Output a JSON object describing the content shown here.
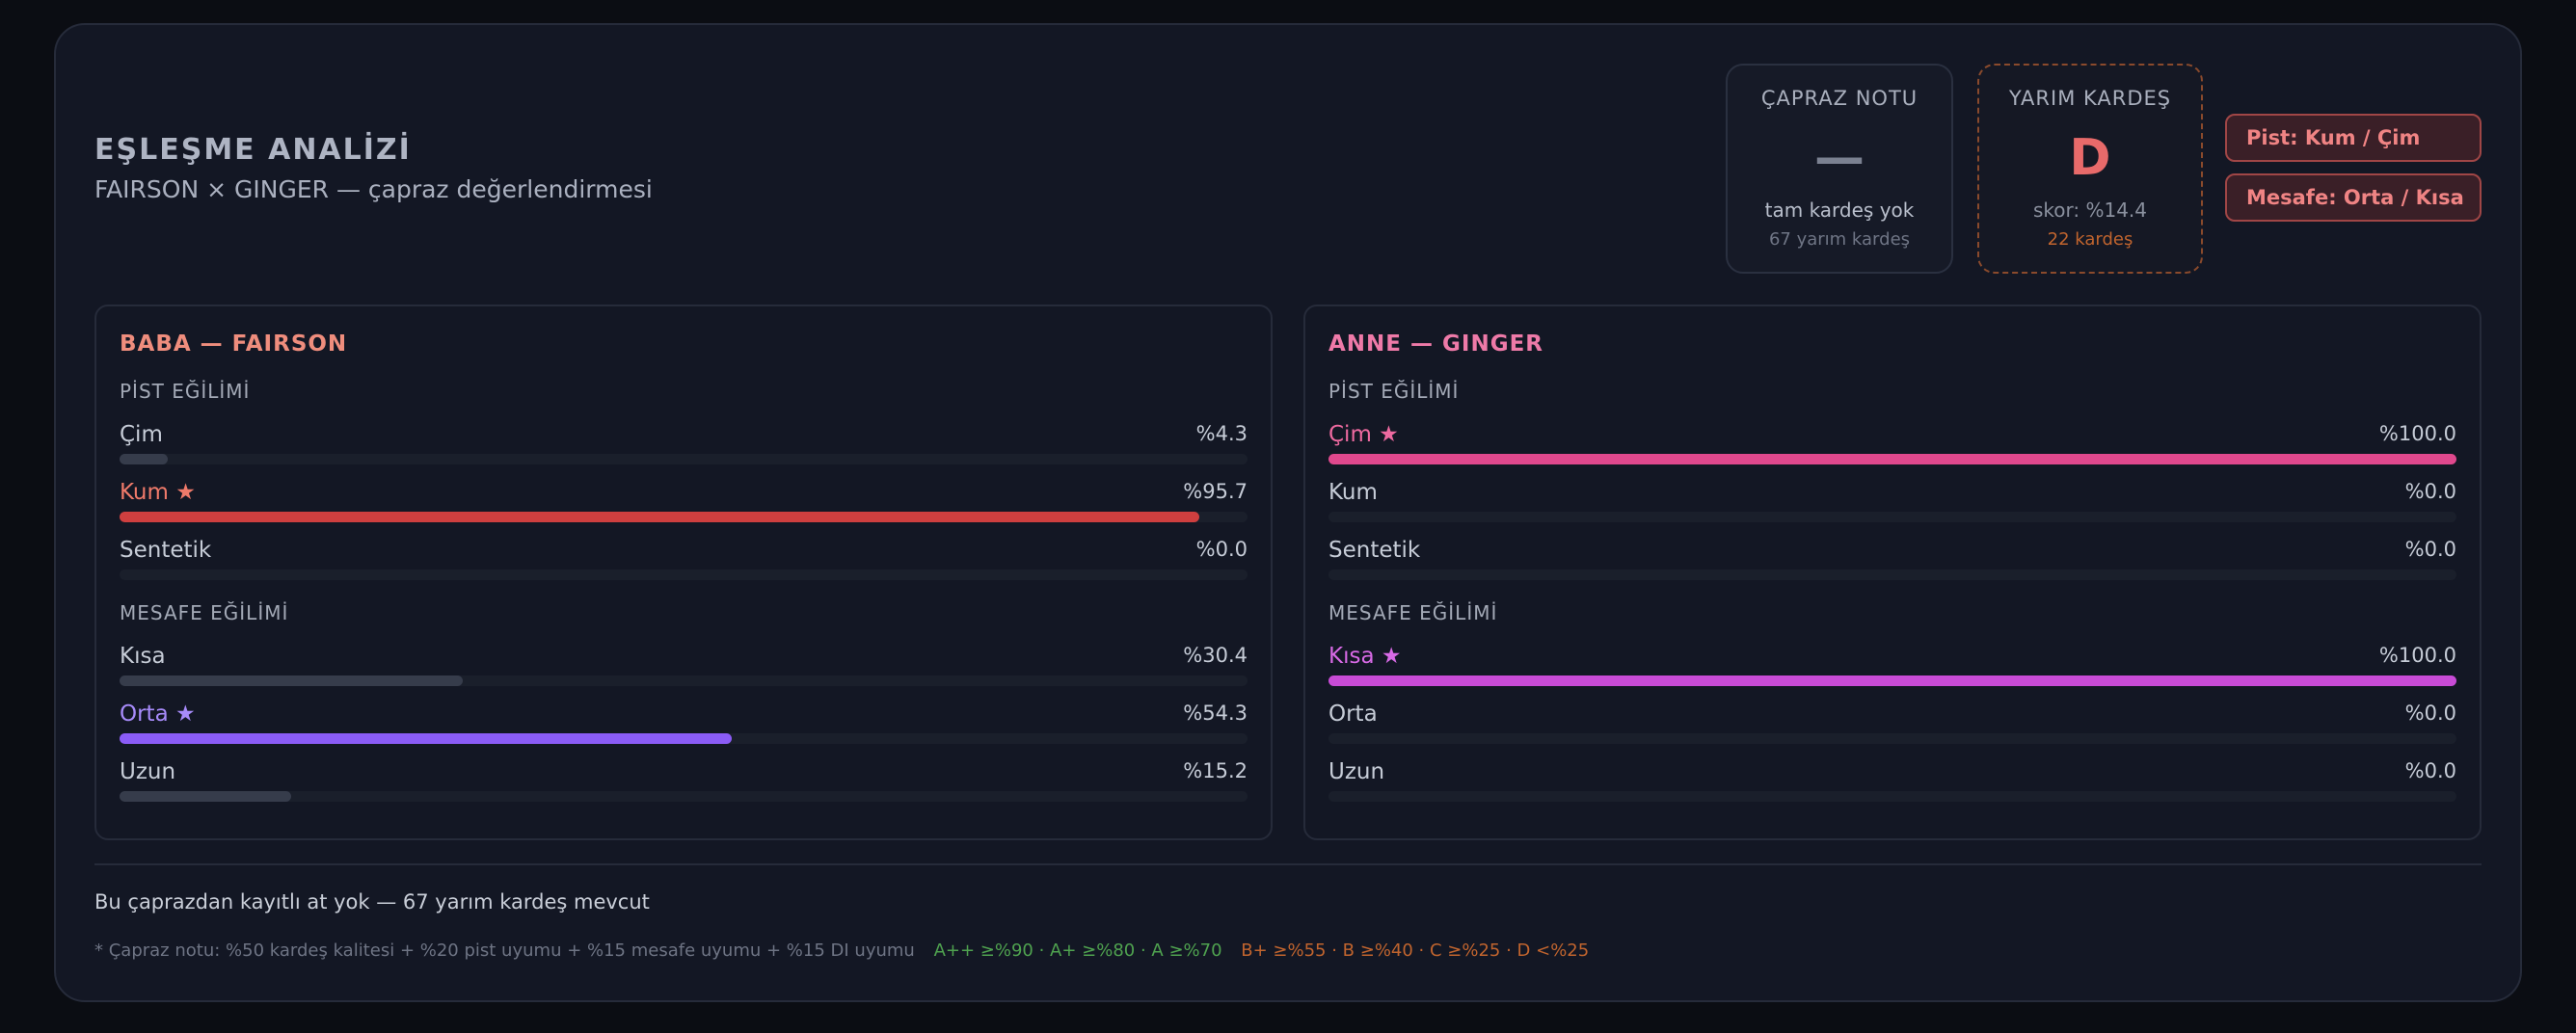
{
  "header": {
    "title": "EŞLEŞME ANALİZİ",
    "subtitle": "FAIRSON × GINGER — çapraz değerlendirmesi"
  },
  "grades": {
    "capraz": {
      "label": "ÇAPRAZ NOTU",
      "grade": "—",
      "line1": "tam kardeş yok",
      "line2": "67 yarım kardeş"
    },
    "yarim": {
      "label": "YARIM KARDEŞ",
      "grade": "D",
      "line1": "skor: %14.4",
      "line2": "22 kardeş"
    }
  },
  "tags": [
    "Pist: Kum / Çim",
    "Mesafe: Orta / Kısa"
  ],
  "colors": {
    "sire_track_star": "#cf3f3f",
    "sire_distance_star": "#8b5cf6",
    "sire_neutral": "#363c4b",
    "dam_track_star": "#e0488d",
    "dam_distance_star": "#c84bd6"
  },
  "sire": {
    "title": "BABA — FAIRSON",
    "track_section": "PİST EĞİLİMİ",
    "track": [
      {
        "label": "Çim",
        "pct": "%4.3",
        "value": 4.3,
        "star": false
      },
      {
        "label": "Kum ★",
        "pct": "%95.7",
        "value": 95.7,
        "star": true
      },
      {
        "label": "Sentetik",
        "pct": "%0.0",
        "value": 0,
        "star": false
      }
    ],
    "distance_section": "MESAFE EĞİLİMİ",
    "distance": [
      {
        "label": "Kısa",
        "pct": "%30.4",
        "value": 30.4,
        "star": false
      },
      {
        "label": "Orta ★",
        "pct": "%54.3",
        "value": 54.3,
        "star": true
      },
      {
        "label": "Uzun",
        "pct": "%15.2",
        "value": 15.2,
        "star": false
      }
    ]
  },
  "dam": {
    "title": "ANNE — GINGER",
    "track_section": "PİST EĞİLİMİ",
    "track": [
      {
        "label": "Çim ★",
        "pct": "%100.0",
        "value": 100,
        "star": true
      },
      {
        "label": "Kum",
        "pct": "%0.0",
        "value": 0,
        "star": false
      },
      {
        "label": "Sentetik",
        "pct": "%0.0",
        "value": 0,
        "star": false
      }
    ],
    "distance_section": "MESAFE EĞİLİMİ",
    "distance": [
      {
        "label": "Kısa ★",
        "pct": "%100.0",
        "value": 100,
        "star": true
      },
      {
        "label": "Orta",
        "pct": "%0.0",
        "value": 0,
        "star": false
      },
      {
        "label": "Uzun",
        "pct": "%0.0",
        "value": 0,
        "star": false
      }
    ]
  },
  "footer": {
    "note": "Bu çaprazdan kayıtlı at yok — 67 yarım kardeş mevcut",
    "formula": "* Çapraz notu: %50 kardeş kalitesi + %20 pist uyumu + %15 mesafe uyumu + %15 DI uyumu",
    "legend_good": "A++ ≥%90 · A+ ≥%80 · A ≥%70",
    "legend_low": "B+ ≥%55 · B ≥%40 · C ≥%25 · D <%25"
  }
}
